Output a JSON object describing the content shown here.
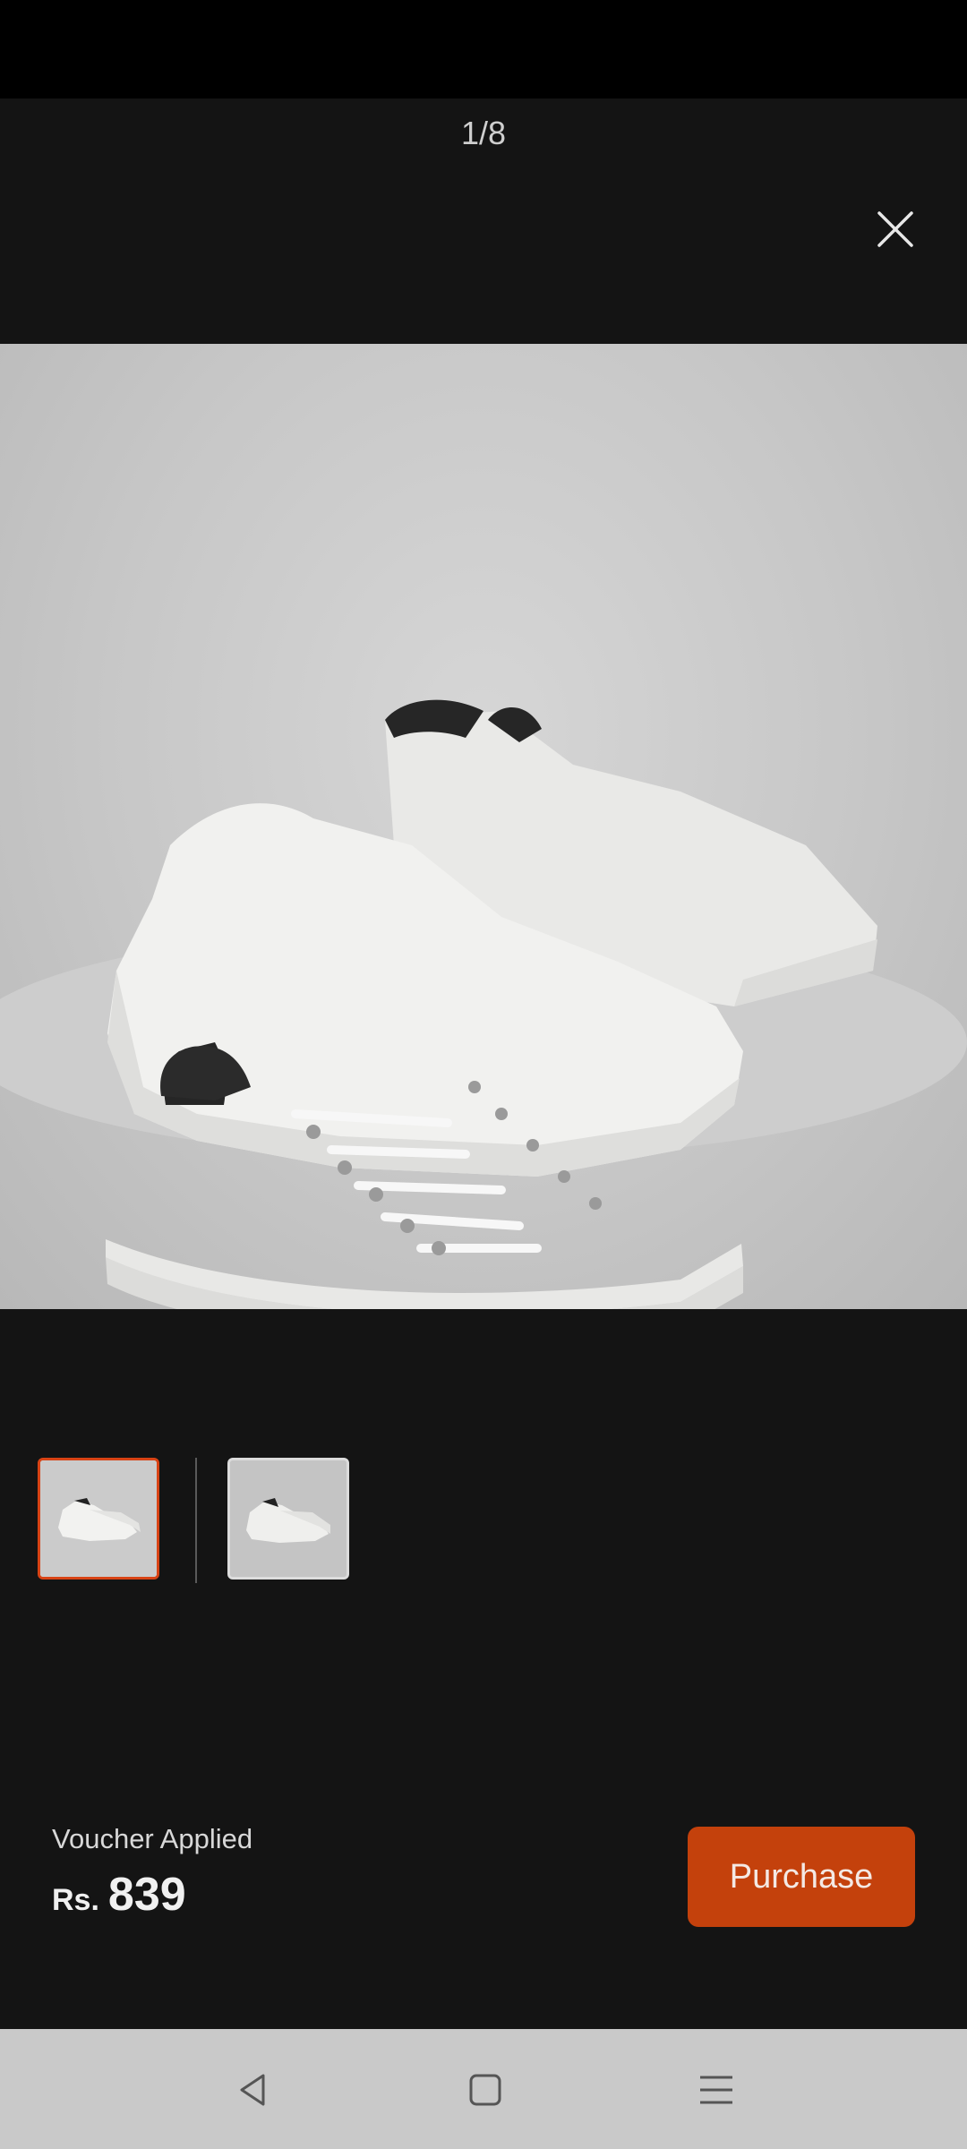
{
  "viewer": {
    "counter": "1/8"
  },
  "icons": {
    "close": "close-icon",
    "back": "back-triangle-icon",
    "home": "home-square-icon",
    "menu": "menu-lines-icon"
  },
  "thumbnails": [
    {
      "label": "sneaker-thumbnail-1",
      "selected": true
    },
    {
      "label": "sneaker-thumbnail-2",
      "selected": false
    }
  ],
  "footer": {
    "voucher_text": "Voucher Applied",
    "currency": "Rs.",
    "price": "839",
    "purchase_label": "Purchase"
  },
  "colors": {
    "accent": "#c4410c",
    "selected_border": "#d84315",
    "background": "#141414"
  }
}
